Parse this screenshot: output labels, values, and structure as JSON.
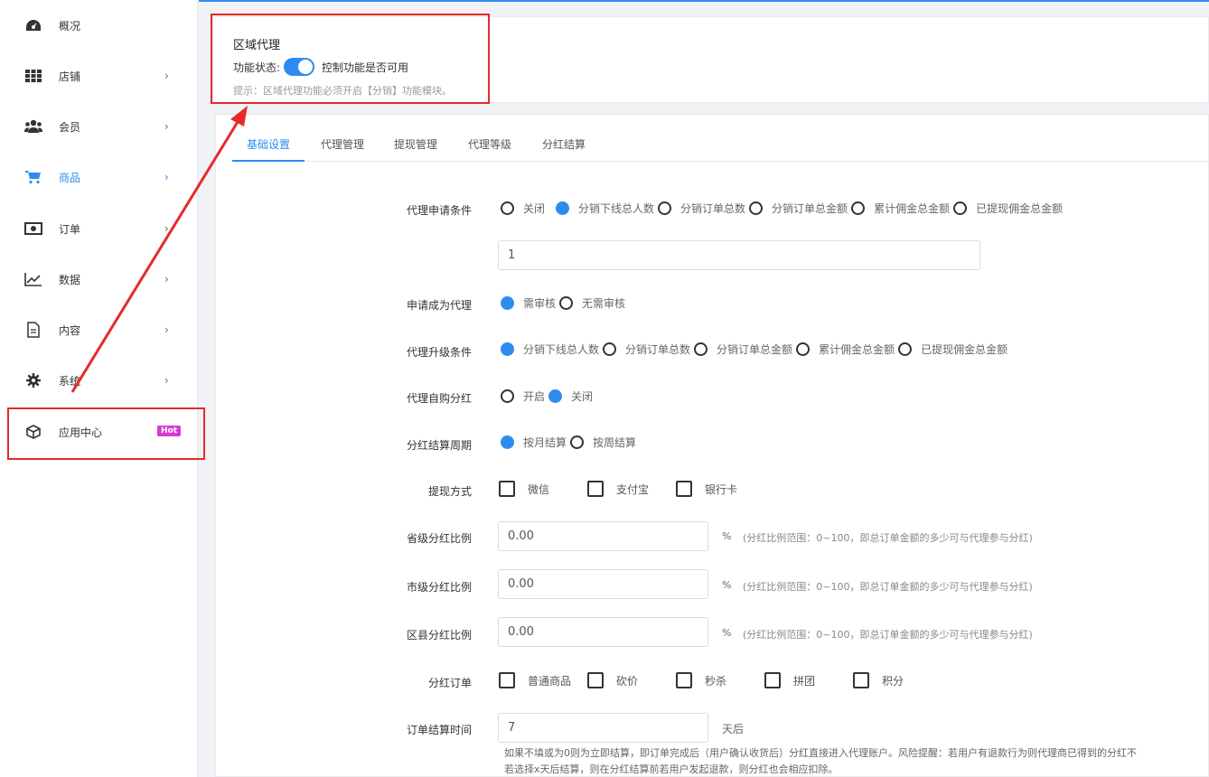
{
  "sidebar": {
    "items": [
      {
        "label": "概况",
        "icon": "dashboard-icon",
        "chevron": ""
      },
      {
        "label": "店铺",
        "icon": "grid-icon",
        "chevron": "›"
      },
      {
        "label": "会员",
        "icon": "users-icon",
        "chevron": "›"
      },
      {
        "label": "商品",
        "icon": "cart-icon",
        "chevron": "›"
      },
      {
        "label": "订单",
        "icon": "money-icon",
        "chevron": "›"
      },
      {
        "label": "数据",
        "icon": "chart-line-icon",
        "chevron": "›"
      },
      {
        "label": "内容",
        "icon": "document-icon",
        "chevron": "›"
      },
      {
        "label": "系统",
        "icon": "gear-icon",
        "chevron": "›"
      },
      {
        "label": "应用中心",
        "icon": "cube-icon",
        "chevron": ""
      }
    ],
    "hot_badge": "Hot",
    "active_color": "#2d8cf0"
  },
  "panel": {
    "title": "区域代理",
    "status_label": "功能状态:",
    "status_desc": "控制功能是否可用",
    "tip": "提示：区域代理功能必须开启【分销】功能模块。"
  },
  "tabs": [
    "基础设置",
    "代理管理",
    "提现管理",
    "代理等级",
    "分红结算"
  ],
  "form": {
    "apply_condition": {
      "label": "代理申请条件",
      "options": [
        "关闭",
        "分销下线总人数",
        "分销订单总数",
        "分销订单总金额",
        "累计佣金总金额",
        "已提现佣金总金额"
      ],
      "value": "1"
    },
    "become_agent": {
      "label": "申请成为代理",
      "options": [
        "需审核",
        "无需审核"
      ]
    },
    "upgrade_condition": {
      "label": "代理升级条件",
      "options": [
        "分销下线总人数",
        "分销订单总数",
        "分销订单总金额",
        "累计佣金总金额",
        "已提现佣金总金额"
      ]
    },
    "self_purchase": {
      "label": "代理自购分红",
      "options": [
        "开启",
        "关闭"
      ]
    },
    "settle_cycle": {
      "label": "分红结算周期",
      "options": [
        "按月结算",
        "按周结算"
      ]
    },
    "withdraw_method": {
      "label": "提现方式",
      "options": [
        "微信",
        "支付宝",
        "银行卡"
      ]
    },
    "province_ratio": {
      "label": "省级分红比例",
      "value": "0.00",
      "unit": "%",
      "hint": "(分红比例范围：0~100，即总订单金额的多少可与代理参与分红)"
    },
    "city_ratio": {
      "label": "市级分红比例",
      "value": "0.00",
      "unit": "%",
      "hint": "(分红比例范围：0~100，即总订单金额的多少可与代理参与分红)"
    },
    "county_ratio": {
      "label": "区县分红比例",
      "value": "0.00",
      "unit": "%",
      "hint": "(分红比例范围：0~100，即总订单金额的多少可与代理参与分红)"
    },
    "bonus_orders": {
      "label": "分红订单",
      "options": [
        "普通商品",
        "砍价",
        "秒杀",
        "拼团",
        "积分"
      ]
    },
    "settle_time": {
      "label": "订单结算时间",
      "value": "7",
      "unit": "天后",
      "note1": "如果不填或为0则为立即结算，即订单完成后（用户确认收货后）分红直接进入代理账户。风险提醒：若用户有退款行为则代理商已得到的分红不",
      "note2": "若选择x天后结算，则在分红结算前若用户发起退款，则分红也会相应扣除。"
    }
  }
}
